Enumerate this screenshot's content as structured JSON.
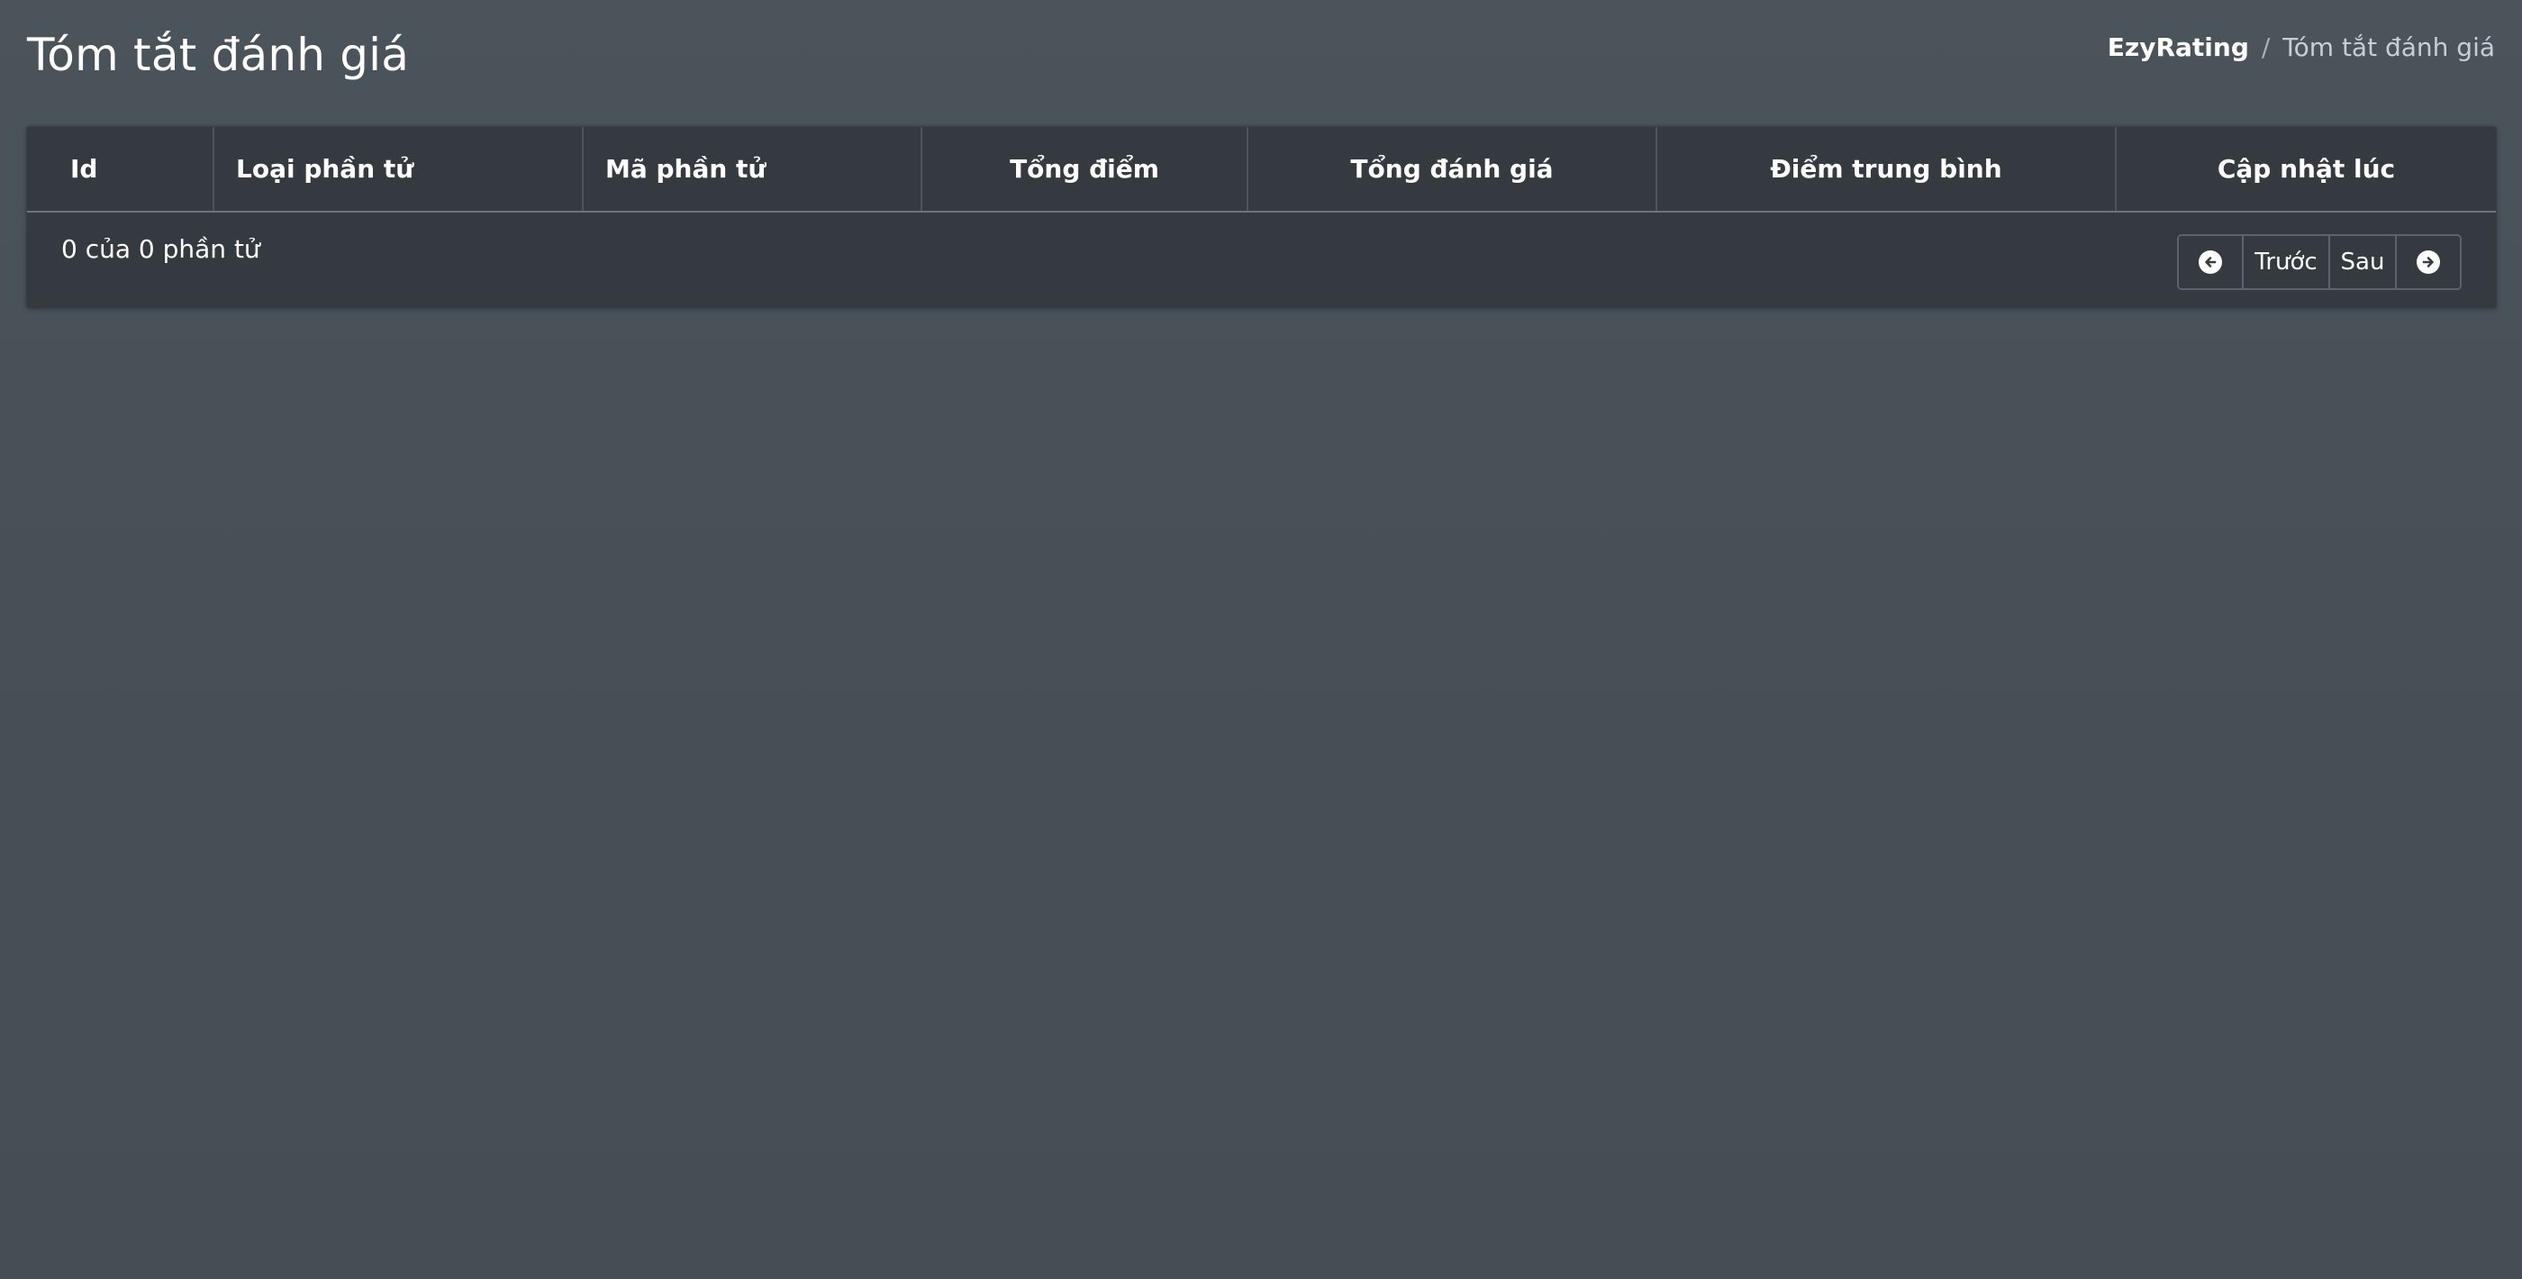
{
  "header": {
    "title": "Tóm tắt đánh giá",
    "breadcrumb": {
      "home": "EzyRating",
      "separator": "/",
      "current": "Tóm tắt đánh giá"
    }
  },
  "table": {
    "columns": {
      "id": "Id",
      "element_type": "Loại phần tử",
      "element_code": "Mã phần tử",
      "total_score": "Tổng điểm",
      "total_ratings": "Tổng đánh giá",
      "average_score": "Điểm trung bình",
      "updated_at": "Cập nhật lúc"
    },
    "rows": []
  },
  "footer": {
    "entries_info": "0 của 0 phần tử",
    "prev_label": "Trước",
    "next_label": "Sau",
    "prev_icon": "arrow-circle-left-icon",
    "next_icon": "arrow-circle-right-icon"
  },
  "colors": {
    "background": "#474f57",
    "card": "#343a40",
    "text": "#ffffff"
  }
}
